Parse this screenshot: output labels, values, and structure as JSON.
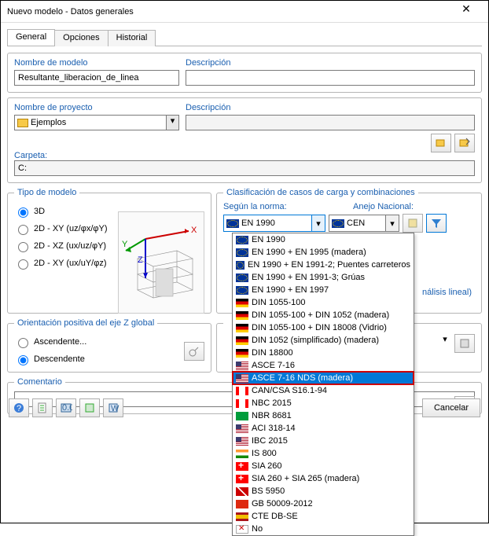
{
  "window": {
    "title": "Nuevo modelo - Datos generales"
  },
  "tabs": {
    "general": "General",
    "opciones": "Opciones",
    "historial": "Historial"
  },
  "model": {
    "name_label": "Nombre de modelo",
    "name_value": "Resultante_liberacion_de_linea",
    "desc_label": "Descripción",
    "desc_value": ""
  },
  "project": {
    "name_label": "Nombre de proyecto",
    "name_value": "Ejemplos",
    "desc_label": "Descripción",
    "desc_value": "",
    "folder_label": "Carpeta:",
    "folder_value": "C:"
  },
  "tipo": {
    "legend": "Tipo de modelo",
    "r3d": "3D",
    "r2dxy": "2D - XY (uz/φx/φY)",
    "r2dxz": "2D - XZ (ux/uz/φY)",
    "r2dxy2": "2D - XY (ux/uY/φz)"
  },
  "clasif": {
    "legend": "Clasificación de casos de carga y combinaciones",
    "norma_label": "Según la norma:",
    "anejo_label": "Anejo Nacional:",
    "norma_value": "EN 1990",
    "anejo_value": "CEN",
    "extra": "nálisis lineal)"
  },
  "orient": {
    "legend": "Orientación positiva del eje Z global",
    "asc": "Ascendente...",
    "desc": "Descendente"
  },
  "comentario": {
    "legend": "Comentario",
    "value": ""
  },
  "dropdown": {
    "items": [
      {
        "flag": "eu",
        "label": "EN 1990"
      },
      {
        "flag": "eu",
        "label": "EN 1990 + EN 1995 (madera)"
      },
      {
        "flag": "eu",
        "label": "EN 1990 + EN 1991-2; Puentes carreteros"
      },
      {
        "flag": "eu",
        "label": "EN 1990 + EN 1991-3; Grúas"
      },
      {
        "flag": "eu",
        "label": "EN 1990 + EN 1997"
      },
      {
        "flag": "de",
        "label": "DIN 1055-100"
      },
      {
        "flag": "de",
        "label": "DIN 1055-100 + DIN 1052 (madera)"
      },
      {
        "flag": "de",
        "label": "DIN 1055-100 + DIN 18008 (Vidrio)"
      },
      {
        "flag": "de",
        "label": "DIN 1052 (simplificado) (madera)"
      },
      {
        "flag": "de",
        "label": "DIN 18800"
      },
      {
        "flag": "us",
        "label": "ASCE 7-16"
      },
      {
        "flag": "us",
        "label": "ASCE 7-16 NDS (madera)"
      },
      {
        "flag": "ca",
        "label": "CAN/CSA S16.1-94"
      },
      {
        "flag": "ca",
        "label": "NBC 2015"
      },
      {
        "flag": "br",
        "label": "NBR 8681"
      },
      {
        "flag": "us",
        "label": "ACI 318-14"
      },
      {
        "flag": "us",
        "label": "IBC 2015"
      },
      {
        "flag": "in",
        "label": "IS 800"
      },
      {
        "flag": "ch",
        "label": "SIA 260"
      },
      {
        "flag": "ch",
        "label": "SIA 260 + SIA 265 (madera)"
      },
      {
        "flag": "uk",
        "label": "BS 5950"
      },
      {
        "flag": "cn",
        "label": "GB 50009-2012"
      },
      {
        "flag": "es",
        "label": "CTE DB-SE"
      },
      {
        "flag": "none",
        "label": "No"
      }
    ],
    "selected_index": 11
  },
  "buttons": {
    "cancel": "Cancelar"
  }
}
